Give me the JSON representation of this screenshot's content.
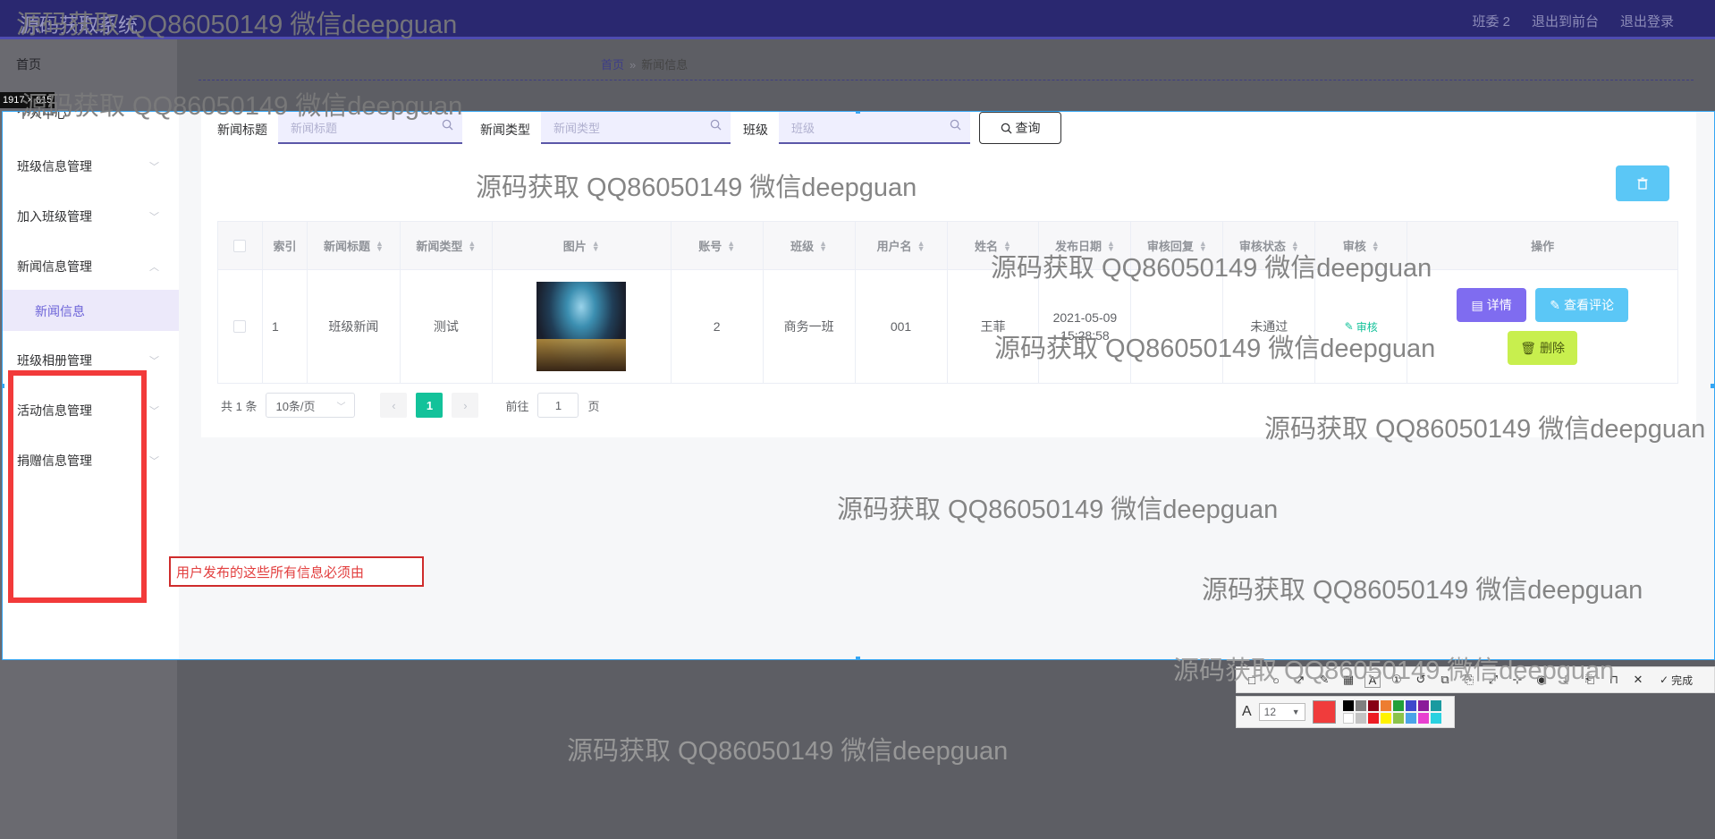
{
  "app": {
    "title": "源码获取系统",
    "top_links": [
      "班委 2",
      "退出到前台",
      "退出登录"
    ],
    "home": "首页"
  },
  "breadcrumb": {
    "home": "首页",
    "separator": "»",
    "current": "新闻信息"
  },
  "capture": {
    "size_label": "1917 × 615"
  },
  "sidebar": {
    "items": [
      {
        "label": "个人中心"
      },
      {
        "label": "班级信息管理"
      },
      {
        "label": "加入班级管理"
      },
      {
        "label": "新闻信息管理"
      },
      {
        "label": "班级相册管理"
      },
      {
        "label": "活动信息管理"
      },
      {
        "label": "捐赠信息管理"
      }
    ],
    "sub_active": "新闻信息"
  },
  "search": {
    "fields": [
      {
        "label": "新闻标题",
        "placeholder": "新闻标题"
      },
      {
        "label": "新闻类型",
        "placeholder": "新闻类型"
      },
      {
        "label": "班级",
        "placeholder": "班级"
      }
    ],
    "button": "查询"
  },
  "table": {
    "headers": [
      "索引",
      "新闻标题",
      "新闻类型",
      "图片",
      "账号",
      "班级",
      "用户名",
      "姓名",
      "发布日期",
      "审核回复",
      "审核状态",
      "审核",
      "操作"
    ],
    "rows": [
      {
        "index": "1",
        "title": "班级新闻",
        "type": "测试",
        "account": "2",
        "class": "商务一班",
        "username": "001",
        "name": "王菲",
        "date": "2021-05-09",
        "time": "15:28:58",
        "reply": "",
        "status": "未通过",
        "audit": "审核"
      }
    ],
    "actions": {
      "detail": "详情",
      "comments": "查看评论",
      "delete": "删除"
    }
  },
  "pagination": {
    "total": "共 1 条",
    "page_size": "10条/页",
    "current": "1",
    "goto_prefix": "前往",
    "goto_value": "1",
    "goto_suffix": "页"
  },
  "annotation": {
    "text": "用户发布的这些所有信息必须由"
  },
  "toolbar": {
    "done": "完成",
    "font_size": "12"
  },
  "watermark": "源码获取 QQ86050149 微信deepguan",
  "colors": {
    "accent": "#6c63d8",
    "brand_bar": "#2a2870",
    "success": "#13c29a",
    "annotation_red": "#f23a3a",
    "selection_blue": "#35a6f3"
  }
}
